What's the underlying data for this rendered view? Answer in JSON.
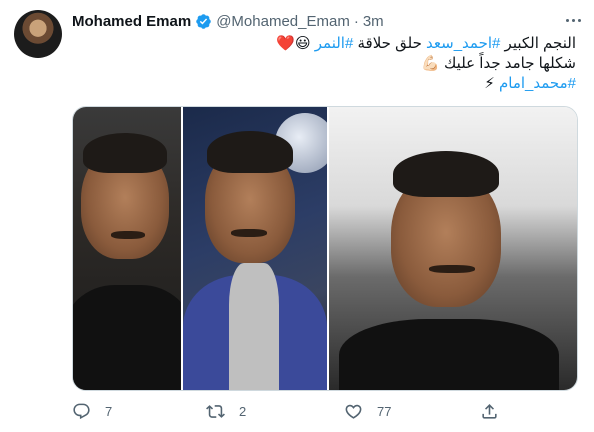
{
  "author": {
    "display_name": "Mohamed Emam",
    "handle": "@Mohamed_Emam",
    "separator": "·",
    "time": "3m"
  },
  "tweet": {
    "line1": {
      "part1": "النجم الكبير ",
      "hashtag1": "#احمد_سعد",
      "part2": " حلق حلاقة ",
      "hashtag2": "#النمر",
      "emoji": " 😃❤️"
    },
    "line2": "شكلها جامد جداً عليك 💪🏻",
    "line3": {
      "hashtag": "#محمد_امام",
      "emoji": " ⚡"
    }
  },
  "actions": {
    "replies": "7",
    "retweets": "2",
    "likes": "77"
  },
  "icons": {
    "verified": "verified-badge-icon",
    "reply": "reply-icon",
    "retweet": "retweet-icon",
    "like": "heart-icon",
    "share": "share-icon",
    "more": "more-options-icon"
  },
  "colors": {
    "accent": "#1d9bf0",
    "muted": "#536471",
    "text": "#0f1419"
  }
}
